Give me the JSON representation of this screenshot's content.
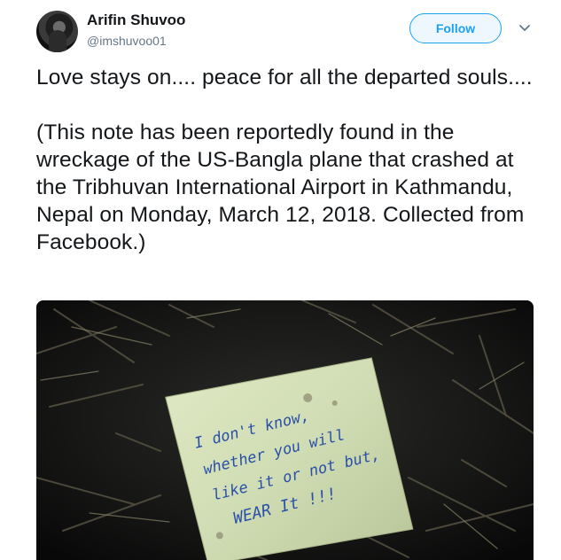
{
  "user": {
    "display_name": "Arifin Shuvoo",
    "handle": "@imshuvoo01"
  },
  "actions": {
    "follow_label": "Follow",
    "menu_icon": "chevron-down-icon"
  },
  "tweet": {
    "line1": "Love stays on.... peace for all the departed souls....",
    "line2": "(This note has been reportedly found in the wreckage of the US-Bangla plane that crashed at the Tribhuvan International Airport in Kathmandu, Nepal on Monday, March 12, 2018. Collected from Facebook.)"
  },
  "media": {
    "note_lines": [
      "I don't know,",
      "whether you will",
      "like it or not but,",
      "WEAR It !!!"
    ]
  },
  "colors": {
    "accent": "#1da1f2",
    "text": "#14171a",
    "secondary": "#657786"
  }
}
